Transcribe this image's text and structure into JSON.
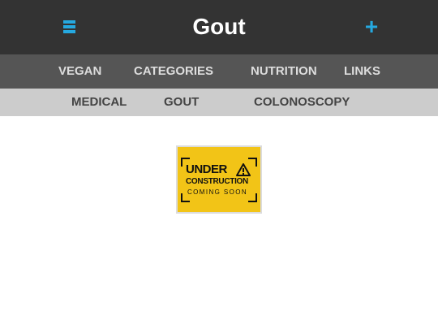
{
  "header": {
    "title": "Gout",
    "menu_icon": "hamburger-menu-icon",
    "add_label": "+",
    "accent_color": "#25a9e0",
    "background_color": "#333333"
  },
  "nav_primary": {
    "background_color": "#555555",
    "items": [
      {
        "label": "VEGAN"
      },
      {
        "label": "CATEGORIES"
      },
      {
        "label": "NUTRITION"
      },
      {
        "label": "LINKS"
      }
    ]
  },
  "nav_secondary": {
    "background_color": "#cccccc",
    "items": [
      {
        "label": "MEDICAL"
      },
      {
        "label": "GOUT"
      },
      {
        "label": "COLONOSCOPY"
      }
    ]
  },
  "main": {
    "sign": {
      "line1": "UNDER",
      "line2": "CONSTRUCTION",
      "line3": "COMING SOON",
      "icon": "warning-icon",
      "color": "#f2c417"
    }
  }
}
